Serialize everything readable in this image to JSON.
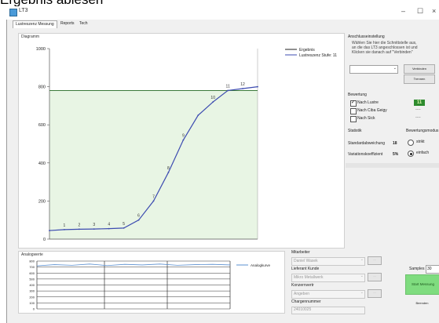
{
  "caption": "Ergebnis ablesen",
  "window": {
    "title": "LT3",
    "minimize": "–",
    "maximize": "☐",
    "close": "×"
  },
  "tabs": [
    {
      "label": "Lustreszenz Messung",
      "active": true
    },
    {
      "label": "Reports"
    },
    {
      "label": "Tech"
    }
  ],
  "diagramm": {
    "title": "Diagramm",
    "legend": [
      "Ergebnis",
      "Lustreszenz Stufe: 11"
    ],
    "yticks": [
      "1000",
      "800",
      "600",
      "400",
      "200",
      "0"
    ]
  },
  "chart_data": [
    {
      "type": "line",
      "title": "",
      "xlabel": "",
      "ylabel": "",
      "ylim": [
        0,
        1000
      ],
      "reference_value": 780,
      "series": [
        {
          "name": "Lustreszenz Stufe: 11",
          "x": [
            0,
            1,
            2,
            3,
            4,
            5,
            6,
            7,
            8,
            9,
            10,
            11,
            12,
            13,
            14
          ],
          "values": [
            45,
            50,
            52,
            53,
            55,
            58,
            100,
            200,
            350,
            520,
            650,
            720,
            780,
            790,
            800
          ]
        }
      ],
      "point_labels": [
        {
          "x": 1,
          "label": "1"
        },
        {
          "x": 2,
          "label": "2"
        },
        {
          "x": 3,
          "label": "3"
        },
        {
          "x": 4,
          "label": "4"
        },
        {
          "x": 5,
          "label": "5"
        },
        {
          "x": 6,
          "label": "6"
        },
        {
          "x": 7,
          "label": "7"
        },
        {
          "x": 8,
          "label": "8"
        },
        {
          "x": 9,
          "label": "9"
        },
        {
          "x": 11,
          "label": "10"
        },
        {
          "x": 12,
          "label": "11"
        },
        {
          "x": 13,
          "label": "12"
        }
      ],
      "colors": {
        "line": "#3c4bb0",
        "area": "#e8f5e4",
        "reference": "#3b7a3b"
      }
    },
    {
      "type": "line",
      "title": "Analogwerte",
      "legend": [
        "Analogkurve"
      ],
      "yticks": [
        "800",
        "700",
        "600",
        "500",
        "400",
        "300",
        "200",
        "100",
        "0"
      ],
      "series": [
        {
          "name": "Analogkurve",
          "values": [
            720,
            740,
            730,
            750,
            725,
            745,
            735,
            750,
            730,
            740,
            745,
            735
          ]
        }
      ]
    }
  ],
  "anschluss": {
    "title": "Anschlusseinstellung",
    "info": [
      "Wählen Sie hier die Schnittstelle aus,",
      "an die das LT3 angeschlossen ist und",
      "Klicken sie danach auf \"Verbinden\""
    ],
    "connect": "Verbinden",
    "disconnect": "Trennen"
  },
  "bewertung": {
    "title": "Bewertung",
    "items": [
      {
        "label": "Nach Lustre",
        "checked": true,
        "value": "11"
      },
      {
        "label": "Nach Ciba Geigy",
        "checked": false,
        "value": "----"
      },
      {
        "label": "Nach Sick",
        "checked": false,
        "value": "----"
      }
    ]
  },
  "statistik": {
    "title": "Statistik",
    "rows": [
      {
        "label": "Standardabweichung",
        "value": "18"
      },
      {
        "label": "Variationskoeffizient",
        "value": "5%"
      }
    ]
  },
  "bewertungsmodus": {
    "title": "Bewertungsmodus",
    "options": [
      {
        "label": "strikt",
        "selected": false
      },
      {
        "label": "einfach",
        "selected": true
      }
    ]
  },
  "form": {
    "mitarbeiter_label": "Mitarbeiter",
    "mitarbeiter_value": "Daniel Wasek",
    "lieferant_label": "Lieferant Kunde",
    "lieferant_value": "Mikro Metallwerk",
    "konzern_label": "Konzernvertr",
    "konzern_value": "Angeben",
    "chargen_label": "Chargennummer",
    "chargen_value": "24010025"
  },
  "bottom": {
    "samples_label": "Samples",
    "samples_value": "30",
    "start": "Start Messung",
    "beenden": "Beenden"
  }
}
